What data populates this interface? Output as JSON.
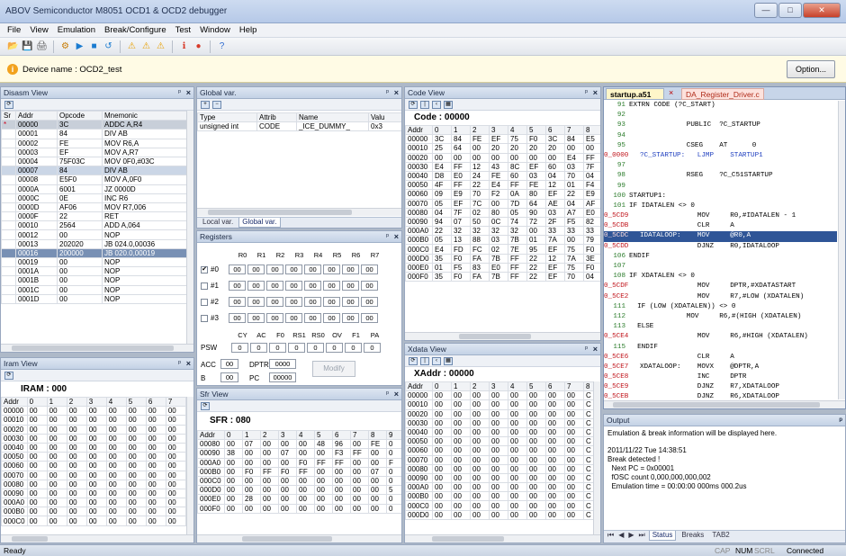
{
  "app": {
    "title": "ABOV Semiconductor M8051 OCD1 & OCD2 debugger"
  },
  "menu": [
    "File",
    "View",
    "Emulation",
    "Break/Configure",
    "Test",
    "Window",
    "Help"
  ],
  "toolbar_icons": [
    "open-icon",
    "save-icon",
    "print-icon",
    "settings-icon",
    "run-icon",
    "stop-icon",
    "reset-icon",
    "warning-icon",
    "warning-icon",
    "warning-icon",
    "info-icon",
    "record-icon",
    "help-icon"
  ],
  "device": {
    "label": "Device name : OCD2_test",
    "option": "Option..."
  },
  "disasm": {
    "title": "Disasm View",
    "headers": [
      "Sr",
      "Addr",
      "Opcode",
      "Mnemonic"
    ],
    "rows": [
      [
        "*",
        "00000",
        "3C",
        "ADDC A,R4"
      ],
      [
        "",
        "00001",
        "84",
        "DIV AB"
      ],
      [
        "",
        "00002",
        "FE",
        "MOV R6,A"
      ],
      [
        "",
        "00003",
        "EF",
        "MOV A,R7"
      ],
      [
        "",
        "00004",
        "75F03C",
        "MOV 0F0,#03C"
      ],
      [
        "",
        "00007",
        "84",
        "DIV AB"
      ],
      [
        "",
        "00008",
        "E5F0",
        "MOV A,0F0"
      ],
      [
        "",
        "0000A",
        "6001",
        "JZ 0000D"
      ],
      [
        "",
        "0000C",
        "0E",
        "INC R6"
      ],
      [
        "",
        "0000D",
        "AF06",
        "MOV R7,006"
      ],
      [
        "",
        "0000F",
        "22",
        "RET"
      ],
      [
        "",
        "00010",
        "2564",
        "ADD A,064"
      ],
      [
        "",
        "00012",
        "00",
        "NOP"
      ],
      [
        "",
        "00013",
        "202020",
        "JB 024.0,00036"
      ],
      [
        "",
        "00016",
        "200000",
        "JB 020.0,00019"
      ],
      [
        "",
        "00019",
        "00",
        "NOP"
      ],
      [
        "",
        "0001A",
        "00",
        "NOP"
      ],
      [
        "",
        "0001B",
        "00",
        "NOP"
      ],
      [
        "",
        "0001C",
        "00",
        "NOP"
      ],
      [
        "",
        "0001D",
        "00",
        "NOP"
      ]
    ]
  },
  "iram": {
    "title": "Iram View",
    "heading": "IRAM : 000",
    "cols": [
      "Addr",
      "0",
      "1",
      "2",
      "3",
      "4",
      "5",
      "6",
      "7"
    ],
    "rows": [
      [
        "00000",
        "00",
        "00",
        "00",
        "00",
        "00",
        "00",
        "00",
        "00"
      ],
      [
        "00010",
        "00",
        "00",
        "00",
        "00",
        "00",
        "00",
        "00",
        "00"
      ],
      [
        "00020",
        "00",
        "00",
        "00",
        "00",
        "00",
        "00",
        "00",
        "00"
      ],
      [
        "00030",
        "00",
        "00",
        "00",
        "00",
        "00",
        "00",
        "00",
        "00"
      ],
      [
        "00040",
        "00",
        "00",
        "00",
        "00",
        "00",
        "00",
        "00",
        "00"
      ],
      [
        "00050",
        "00",
        "00",
        "00",
        "00",
        "00",
        "00",
        "00",
        "00"
      ],
      [
        "00060",
        "00",
        "00",
        "00",
        "00",
        "00",
        "00",
        "00",
        "00"
      ],
      [
        "00070",
        "00",
        "00",
        "00",
        "00",
        "00",
        "00",
        "00",
        "00"
      ],
      [
        "00080",
        "00",
        "00",
        "00",
        "00",
        "00",
        "00",
        "00",
        "00"
      ],
      [
        "00090",
        "00",
        "00",
        "00",
        "00",
        "00",
        "00",
        "00",
        "00"
      ],
      [
        "000A0",
        "00",
        "00",
        "00",
        "00",
        "00",
        "00",
        "00",
        "00"
      ],
      [
        "000B0",
        "00",
        "00",
        "00",
        "00",
        "00",
        "00",
        "00",
        "00"
      ],
      [
        "000C0",
        "00",
        "00",
        "00",
        "00",
        "00",
        "00",
        "00",
        "00"
      ]
    ]
  },
  "globals": {
    "title": "Global var.",
    "headers": [
      "Type",
      "Attrib",
      "Name",
      "Valu"
    ],
    "rows": [
      [
        "unsigned int",
        "CODE",
        "_ICE_DUMMY_",
        "0x3"
      ]
    ],
    "tabs": [
      "Local var.",
      "Global var."
    ]
  },
  "registers": {
    "title": "Registers",
    "cols": [
      "R0",
      "R1",
      "R2",
      "R3",
      "R4",
      "R5",
      "R6",
      "R7"
    ],
    "banks": [
      {
        "label": "#0",
        "checked": "✔",
        "vals": [
          "00",
          "00",
          "00",
          "00",
          "00",
          "00",
          "00",
          "00"
        ]
      },
      {
        "label": "#1",
        "checked": "",
        "vals": [
          "00",
          "00",
          "00",
          "00",
          "00",
          "00",
          "00",
          "00"
        ]
      },
      {
        "label": "#2",
        "checked": "",
        "vals": [
          "00",
          "00",
          "00",
          "00",
          "00",
          "00",
          "00",
          "00"
        ]
      },
      {
        "label": "#3",
        "checked": "",
        "vals": [
          "00",
          "00",
          "00",
          "00",
          "00",
          "00",
          "00",
          "00"
        ]
      }
    ],
    "psw_cols": [
      "CY",
      "AC",
      "F0",
      "RS1",
      "RS0",
      "OV",
      "F1",
      "PA"
    ],
    "psw_label": "PSW",
    "psw_vals": [
      "0",
      "0",
      "0",
      "0",
      "0",
      "0",
      "0",
      "0"
    ],
    "acc_label": "ACC",
    "acc": "00",
    "dptr_label": "DPTR",
    "dptr": "0000",
    "b_label": "B",
    "b": "00",
    "pc_label": "PC",
    "pc": "00000",
    "modify": "Modify"
  },
  "sfr": {
    "title": "Sfr View",
    "heading": "SFR : 080",
    "cols": [
      "Addr",
      "0",
      "1",
      "2",
      "3",
      "4",
      "5",
      "6",
      "7",
      "8",
      "9"
    ],
    "rows": [
      [
        "00080",
        "00",
        "07",
        "00",
        "00",
        "00",
        "48",
        "96",
        "00",
        "FE",
        "0"
      ],
      [
        "00090",
        "38",
        "00",
        "00",
        "07",
        "00",
        "00",
        "F3",
        "FF",
        "00",
        "0"
      ],
      [
        "000A0",
        "00",
        "00",
        "00",
        "00",
        "F0",
        "FF",
        "FF",
        "00",
        "00",
        "F"
      ],
      [
        "000B0",
        "00",
        "F0",
        "FF",
        "F0",
        "FF",
        "00",
        "00",
        "00",
        "07",
        "0"
      ],
      [
        "000C0",
        "00",
        "00",
        "00",
        "00",
        "00",
        "00",
        "00",
        "00",
        "00",
        "0"
      ],
      [
        "000D0",
        "00",
        "00",
        "00",
        "00",
        "00",
        "00",
        "00",
        "00",
        "00",
        "5"
      ],
      [
        "000E0",
        "00",
        "28",
        "00",
        "00",
        "00",
        "00",
        "00",
        "00",
        "00",
        "0"
      ],
      [
        "000F0",
        "00",
        "00",
        "00",
        "00",
        "00",
        "00",
        "00",
        "00",
        "00",
        "0"
      ]
    ]
  },
  "code": {
    "title": "Code View",
    "heading": "Code : 00000",
    "cols": [
      "Addr",
      "0",
      "1",
      "2",
      "3",
      "4",
      "5",
      "6",
      "7",
      "8"
    ],
    "rows": [
      [
        "00000",
        "3C",
        "84",
        "FE",
        "EF",
        "75",
        "F0",
        "3C",
        "84",
        "E5"
      ],
      [
        "00010",
        "25",
        "64",
        "00",
        "20",
        "20",
        "20",
        "20",
        "00",
        "00"
      ],
      [
        "00020",
        "00",
        "00",
        "00",
        "00",
        "00",
        "00",
        "00",
        "E4",
        "FF"
      ],
      [
        "00030",
        "E4",
        "FF",
        "12",
        "43",
        "8C",
        "EF",
        "60",
        "03",
        "7F"
      ],
      [
        "00040",
        "D8",
        "E0",
        "24",
        "FE",
        "60",
        "03",
        "04",
        "70",
        "04"
      ],
      [
        "00050",
        "4F",
        "FF",
        "22",
        "E4",
        "FF",
        "FE",
        "12",
        "01",
        "F4"
      ],
      [
        "00060",
        "09",
        "E9",
        "70",
        "F2",
        "0A",
        "80",
        "EF",
        "22",
        "E9"
      ],
      [
        "00070",
        "05",
        "EF",
        "7C",
        "00",
        "7D",
        "64",
        "AE",
        "04",
        "AF"
      ],
      [
        "00080",
        "04",
        "7F",
        "02",
        "80",
        "05",
        "90",
        "03",
        "A7",
        "E0"
      ],
      [
        "00090",
        "94",
        "07",
        "50",
        "0C",
        "74",
        "72",
        "2F",
        "F5",
        "82"
      ],
      [
        "000A0",
        "22",
        "32",
        "32",
        "32",
        "32",
        "00",
        "33",
        "33",
        "33"
      ],
      [
        "000B0",
        "05",
        "13",
        "88",
        "03",
        "7B",
        "01",
        "7A",
        "00",
        "79"
      ],
      [
        "000C0",
        "E4",
        "FD",
        "FC",
        "02",
        "7E",
        "95",
        "EF",
        "75",
        "F0"
      ],
      [
        "000D0",
        "35",
        "F0",
        "FA",
        "7B",
        "FF",
        "22",
        "12",
        "7A",
        "3E"
      ],
      [
        "000E0",
        "01",
        "F5",
        "83",
        "E0",
        "FF",
        "22",
        "EF",
        "75",
        "F0"
      ],
      [
        "000F0",
        "35",
        "F0",
        "FA",
        "7B",
        "FF",
        "22",
        "EF",
        "70",
        "04"
      ]
    ]
  },
  "xdata": {
    "title": "Xdata View",
    "heading": "XAddr : 00000",
    "cols": [
      "Addr",
      "0",
      "1",
      "2",
      "3",
      "4",
      "5",
      "6",
      "7",
      "8"
    ],
    "rows": [
      [
        "00000",
        "00",
        "00",
        "00",
        "00",
        "00",
        "00",
        "00",
        "00",
        "C"
      ],
      [
        "00010",
        "00",
        "00",
        "00",
        "00",
        "00",
        "00",
        "00",
        "00",
        "C"
      ],
      [
        "00020",
        "00",
        "00",
        "00",
        "00",
        "00",
        "00",
        "00",
        "00",
        "C"
      ],
      [
        "00030",
        "00",
        "00",
        "00",
        "00",
        "00",
        "00",
        "00",
        "00",
        "C"
      ],
      [
        "00040",
        "00",
        "00",
        "00",
        "00",
        "00",
        "00",
        "00",
        "00",
        "C"
      ],
      [
        "00050",
        "00",
        "00",
        "00",
        "00",
        "00",
        "00",
        "00",
        "00",
        "C"
      ],
      [
        "00060",
        "00",
        "00",
        "00",
        "00",
        "00",
        "00",
        "00",
        "00",
        "C"
      ],
      [
        "00070",
        "00",
        "00",
        "00",
        "00",
        "00",
        "00",
        "00",
        "00",
        "C"
      ],
      [
        "00080",
        "00",
        "00",
        "00",
        "00",
        "00",
        "00",
        "00",
        "00",
        "C"
      ],
      [
        "00090",
        "00",
        "00",
        "00",
        "00",
        "00",
        "00",
        "00",
        "00",
        "C"
      ],
      [
        "000A0",
        "00",
        "00",
        "00",
        "00",
        "00",
        "00",
        "00",
        "00",
        "C"
      ],
      [
        "000B0",
        "00",
        "00",
        "00",
        "00",
        "00",
        "00",
        "00",
        "00",
        "C"
      ],
      [
        "000C0",
        "00",
        "00",
        "00",
        "00",
        "00",
        "00",
        "00",
        "00",
        "C"
      ],
      [
        "000D0",
        "00",
        "00",
        "00",
        "00",
        "00",
        "00",
        "00",
        "00",
        "C"
      ]
    ]
  },
  "editor": {
    "tabs": [
      "startup.a51",
      "DA_Register_Driver.c"
    ],
    "lines": [
      {
        "ln": "91",
        "addr": "",
        "text": "EXTRN CODE (?C_START)",
        "hl": ""
      },
      {
        "ln": "92",
        "addr": "",
        "text": "",
        "hl": ""
      },
      {
        "ln": "93",
        "addr": "",
        "text": "              PUBLIC  ?C_STARTUP",
        "hl": ""
      },
      {
        "ln": "94",
        "addr": "",
        "text": "",
        "hl": ""
      },
      {
        "ln": "95",
        "addr": "",
        "text": "              CSEG    AT      0",
        "hl": ""
      },
      {
        "ln": "",
        "addr": "0_0000",
        "text": "?C_STARTUP:   LJMP    STARTUP1",
        "hl": "blue"
      },
      {
        "ln": "97",
        "addr": "",
        "text": "",
        "hl": ""
      },
      {
        "ln": "98",
        "addr": "",
        "text": "              RSEG    ?C_C51STARTUP",
        "hl": ""
      },
      {
        "ln": "99",
        "addr": "",
        "text": "",
        "hl": ""
      },
      {
        "ln": "100",
        "addr": "",
        "text": "STARTUP1:",
        "hl": ""
      },
      {
        "ln": "101",
        "addr": "",
        "text": "IF IDATALEN <> 0",
        "hl": ""
      },
      {
        "ln": "",
        "addr": "0_5CD9",
        "text": "              MOV     R0,#IDATALEN - 1",
        "hl": ""
      },
      {
        "ln": "",
        "addr": "0_5CDB",
        "text": "              CLR     A",
        "hl": ""
      },
      {
        "ln": "",
        "addr": "0_5CDC",
        "text": "IDATALOOP:    MOV     @R0,A",
        "hl": "sel"
      },
      {
        "ln": "",
        "addr": "0_5CDD",
        "text": "              DJNZ    R0,IDATALOOP",
        "hl": ""
      },
      {
        "ln": "106",
        "addr": "",
        "text": "ENDIF",
        "hl": ""
      },
      {
        "ln": "107",
        "addr": "",
        "text": "",
        "hl": ""
      },
      {
        "ln": "108",
        "addr": "",
        "text": "IF XDATALEN <> 0",
        "hl": ""
      },
      {
        "ln": "",
        "addr": "0_5CDF",
        "text": "              MOV     DPTR,#XDATASTART",
        "hl": ""
      },
      {
        "ln": "",
        "addr": "0_5CE2",
        "text": "              MOV     R7,#LOW (XDATALEN)",
        "hl": ""
      },
      {
        "ln": "111",
        "addr": "",
        "text": "  IF (LOW (XDATALEN)) <> 0",
        "hl": ""
      },
      {
        "ln": "112",
        "addr": "",
        "text": "              MOV     R6,#(HIGH (XDATALEN)",
        "hl": ""
      },
      {
        "ln": "113",
        "addr": "",
        "text": "  ELSE",
        "hl": ""
      },
      {
        "ln": "",
        "addr": "0_5CE4",
        "text": "              MOV     R6,#HIGH (XDATALEN)",
        "hl": ""
      },
      {
        "ln": "115",
        "addr": "",
        "text": "  ENDIF",
        "hl": ""
      },
      {
        "ln": "",
        "addr": "0_5CE6",
        "text": "              CLR     A",
        "hl": ""
      },
      {
        "ln": "",
        "addr": "0_5CE7",
        "text": "XDATALOOP:    MOVX    @DPTR,A",
        "hl": ""
      },
      {
        "ln": "",
        "addr": "0_5CE8",
        "text": "              INC     DPTR",
        "hl": ""
      },
      {
        "ln": "",
        "addr": "0_5CE9",
        "text": "              DJNZ    R7,XDATALOOP",
        "hl": ""
      },
      {
        "ln": "",
        "addr": "0_5CEB",
        "text": "              DJNZ    R6,XDATALOOP",
        "hl": ""
      },
      {
        "ln": "121",
        "addr": "",
        "text": "ENDIF",
        "hl": ""
      },
      {
        "ln": "122",
        "addr": "",
        "text": "",
        "hl": ""
      }
    ]
  },
  "output": {
    "title": "Output",
    "lines": [
      "Emulation & break information will be displayed here.",
      "",
      "2011/11/22 Tue 14:38:51",
      "Break detected !",
      "  Next PC = 0x00001",
      "  fOSC count 0,000,000,000,002",
      "  Emulation time = 00:00:00 000ms 000.2us"
    ],
    "tabs": [
      "Status",
      "Breaks",
      "TAB2"
    ]
  },
  "status": {
    "left": "Ready",
    "cap": "CAP",
    "num": "NUM",
    "scrl": "SCRL",
    "conn": "Connected"
  }
}
